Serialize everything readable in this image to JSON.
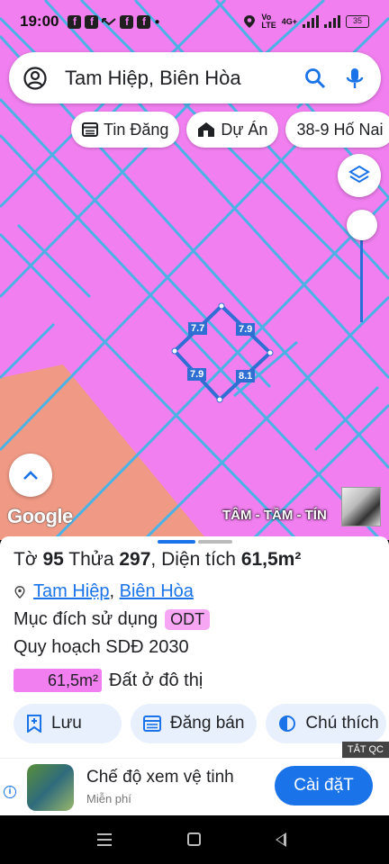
{
  "status_bar": {
    "time": "19:00",
    "network": "4G+",
    "battery": "35"
  },
  "search": {
    "text": "Tam Hiệp, Biên Hòa"
  },
  "chips": [
    {
      "label": "Tin Đăng",
      "icon": "listing-icon"
    },
    {
      "label": "Dự Án",
      "icon": "project-icon"
    },
    {
      "label": "38-9 Hố Nai",
      "icon": ""
    }
  ],
  "map": {
    "edge_labels": {
      "top_left": "7.7",
      "top_right": "7.9",
      "bottom_left": "7.9",
      "bottom_right": "8.1"
    },
    "google_logo": "Google",
    "agent_name": "TÂM - TẦM - TÍN",
    "colors": {
      "residential": "#f17ff0",
      "other_zone": "#f09a85",
      "roads": "#4bb2e6"
    }
  },
  "parcel": {
    "sheet_label": "Tờ",
    "sheet_no": "95",
    "plot_label": "Thửa",
    "plot_no": "297",
    "area_label": "Diện tích",
    "area_value": "61,5m²",
    "ward": "Tam Hiệp",
    "city": "Biên Hòa",
    "purpose_label": "Mục đích sử dụng",
    "purpose_code": "ODT",
    "plan_label": "Quy hoạch SDĐ 2030",
    "plan_area": "61,5m²",
    "plan_type": "Đất ở đô thị"
  },
  "actions": [
    {
      "label": "Lưu",
      "icon": "save-icon"
    },
    {
      "label": "Đăng bán",
      "icon": "sell-icon"
    },
    {
      "label": "Chú thích",
      "icon": "legend-icon"
    }
  ],
  "ad_close_label": "TẮT QC",
  "ad": {
    "title": "Chế độ xem vệ tinh",
    "subtitle": "Miễn phí",
    "cta": "Cài đặT"
  }
}
